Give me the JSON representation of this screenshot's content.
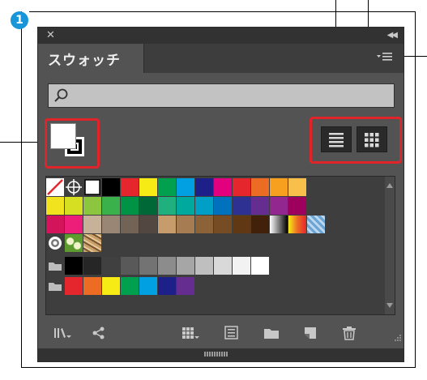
{
  "step_badge": "1",
  "panel": {
    "tab_label": "スウォッチ",
    "menu_icon": "panel-menu-icon",
    "search": {
      "placeholder": "",
      "icon": "search-icon"
    }
  },
  "colors": {
    "accent_red": "#e0242a",
    "badge_blue": "#1a95d8",
    "panel_bg": "#535353"
  },
  "swatch_rows": [
    [
      "none",
      "registration",
      "white",
      "#000000",
      "#e5262c",
      "#f6eb14",
      "#00a04e",
      "#00a0e3",
      "#1d2088",
      "#e3007f",
      "#e5262c",
      "#ed6c24",
      "#f7a01f",
      "#f8bf4a"
    ],
    [
      "#f1e31d",
      "#d7df22",
      "#8cc63f",
      "#3ab14a",
      "#009245",
      "#006837",
      "#20b07e",
      "#00a99d",
      "#00a0c6",
      "#0071bc",
      "#2e3192",
      "#662d91",
      "#92278f",
      "#9e005d"
    ],
    [
      "#d4145a",
      "#ed1e79",
      "#c7b299",
      "#998675",
      "#736357",
      "#534741",
      "#c69c6d",
      "#a67c52",
      "#8c6239",
      "#754c24",
      "#603813",
      "#42210b",
      "gradient-bw",
      "gradient-orange",
      "pattern-blue"
    ],
    [
      "pattern-white",
      "pattern-leaf",
      "pattern-tan"
    ],
    [
      "folder",
      "#000000",
      "#262626",
      "#404040",
      "#595959",
      "#737373",
      "#8c8c8c",
      "#a6a6a6",
      "#bfbfbf",
      "#d9d9d9",
      "#f2f2f2",
      "#ffffff"
    ],
    [
      "folder",
      "#e5262c",
      "#ed6c24",
      "#f6eb14",
      "#00a04e",
      "#00a0e3",
      "#1d2088",
      "#662d91"
    ]
  ],
  "bottom_icons": [
    "swatch-library-icon",
    "place-swatches-icon",
    "show-kind-icon",
    "swatch-options-icon",
    "new-color-group-icon",
    "new-swatch-icon",
    "delete-swatch-icon"
  ]
}
